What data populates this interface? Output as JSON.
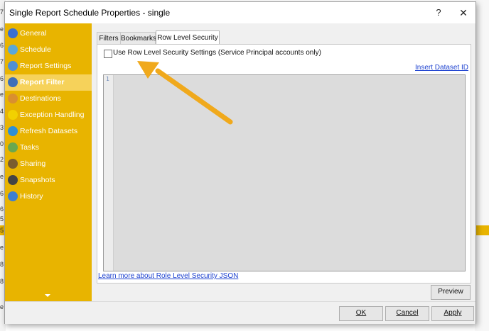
{
  "window": {
    "title": "Single Report Schedule Properties - single",
    "help_label": "?",
    "close_label": "✕"
  },
  "background_edge_chars": [
    "7",
    "e",
    "6",
    "7",
    "6",
    "e",
    "4",
    "3",
    "0",
    "2",
    "e",
    "6",
    "6",
    "5",
    "5",
    "e",
    "8",
    "8",
    "e"
  ],
  "sidebar": {
    "items": [
      {
        "label": "General",
        "icon": "info-icon",
        "icon_color": "#3b6fd1",
        "active": false
      },
      {
        "label": "Schedule",
        "icon": "clock-icon",
        "icon_color": "#5aa7d8",
        "active": false
      },
      {
        "label": "Report Settings",
        "icon": "report-settings-icon",
        "icon_color": "#4e8fd6",
        "active": false
      },
      {
        "label": "Report Filter",
        "icon": "report-filter-icon",
        "icon_color": "#3e6fb8",
        "active": true
      },
      {
        "label": "Destinations",
        "icon": "destinations-icon",
        "icon_color": "#d98f2f",
        "active": false
      },
      {
        "label": "Exception Handling",
        "icon": "warning-icon",
        "icon_color": "#f2d100",
        "active": false
      },
      {
        "label": "Refresh Datasets",
        "icon": "refresh-icon",
        "icon_color": "#2e8fd6",
        "active": false
      },
      {
        "label": "Tasks",
        "icon": "tasks-icon",
        "icon_color": "#6aa84f",
        "active": false
      },
      {
        "label": "Sharing",
        "icon": "sharing-icon",
        "icon_color": "#7a5c2e",
        "active": false
      },
      {
        "label": "Snapshots",
        "icon": "camera-icon",
        "icon_color": "#444444",
        "active": false
      },
      {
        "label": "History",
        "icon": "history-icon",
        "icon_color": "#3d7fd1",
        "active": false
      }
    ],
    "scroll_down_icon": "chevron-down-icon"
  },
  "tabs": [
    {
      "label": "Filters",
      "active": false
    },
    {
      "label": "Bookmarks",
      "active": false
    },
    {
      "label": "Row Level Security",
      "active": true
    }
  ],
  "rls": {
    "checkbox_label": "Use Row Level Security Settings (Service Principal accounts only)",
    "checkbox_checked": false,
    "insert_dataset_link": "Insert Dataset ID",
    "editor_line_number": "1",
    "learn_more_link": "Learn more about Role Level Security JSON"
  },
  "buttons": {
    "preview": "Preview",
    "ok": "OK",
    "cancel": "Cancel",
    "apply": "Apply"
  },
  "colors": {
    "sidebar_bg": "#e8b400",
    "sidebar_active_bg": "#f6d25a",
    "arrow": "#f0a91c",
    "link": "#1f43d0"
  }
}
